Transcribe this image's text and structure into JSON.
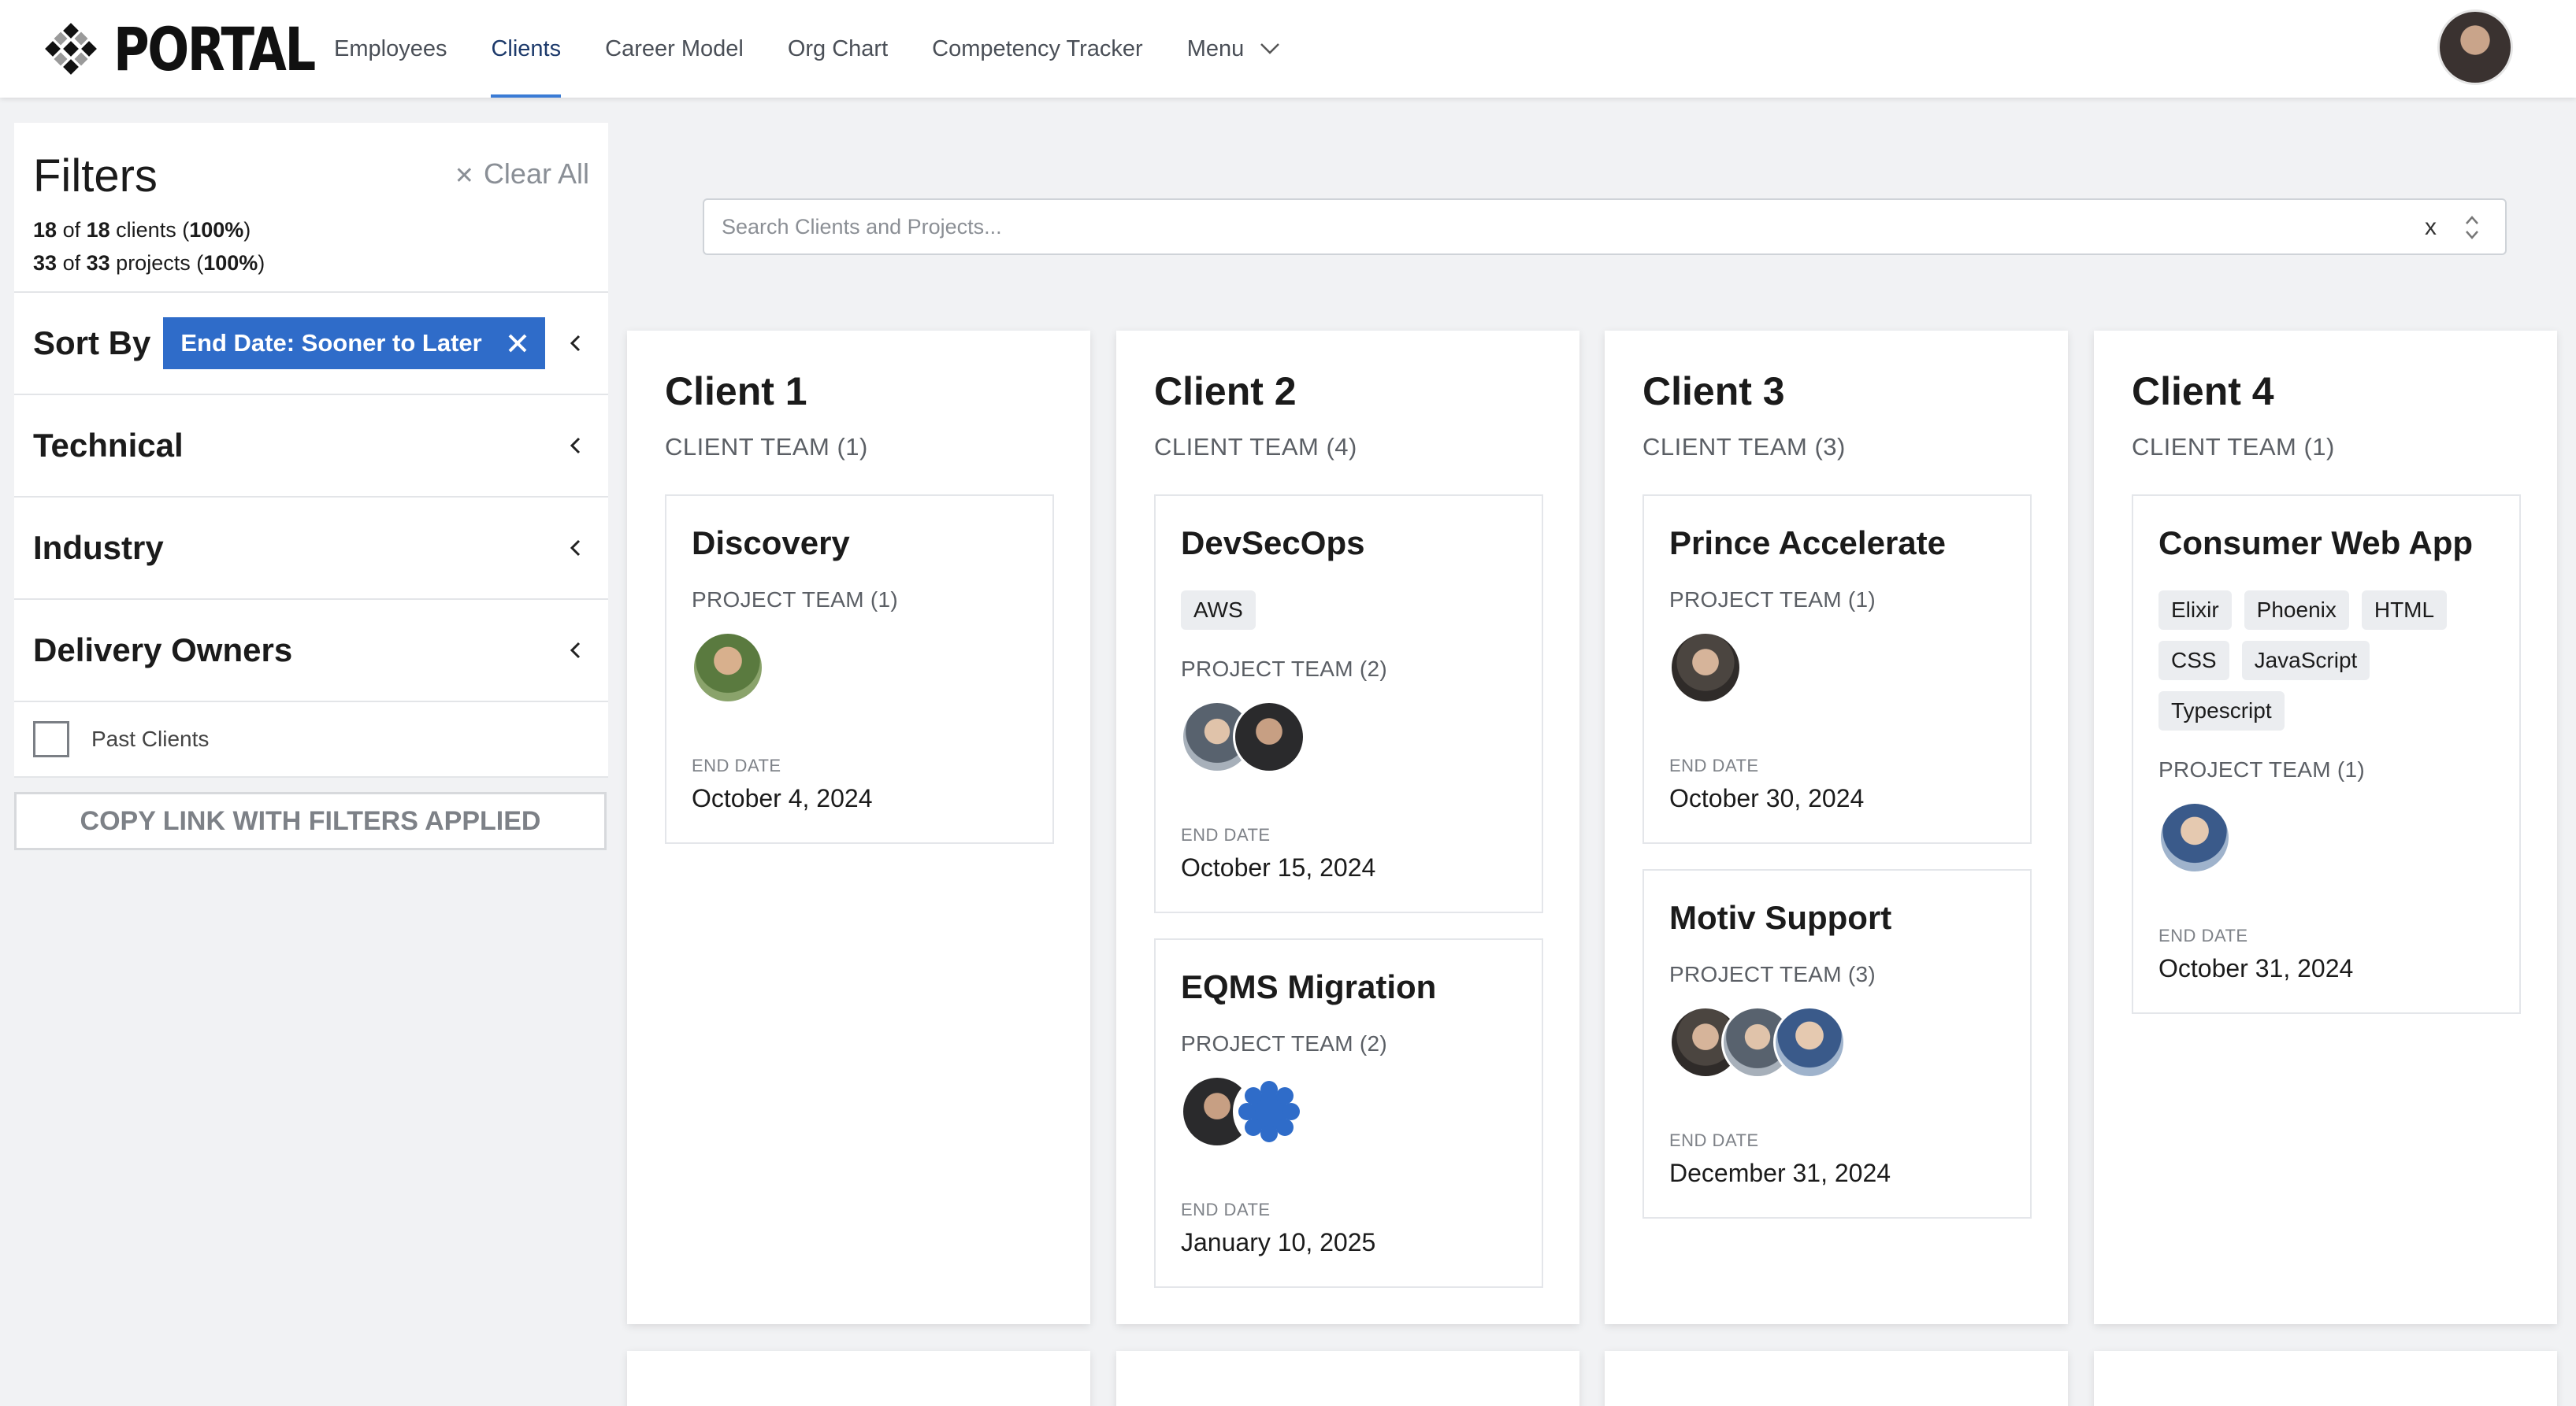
{
  "app": {
    "logo_text": "PORTAL"
  },
  "nav": {
    "items": [
      {
        "label": "Employees"
      },
      {
        "label": "Clients"
      },
      {
        "label": "Career Model"
      },
      {
        "label": "Org Chart"
      },
      {
        "label": "Competency Tracker"
      },
      {
        "label": "Menu"
      }
    ],
    "active": "Clients"
  },
  "filters": {
    "title": "Filters",
    "clear_all": "Clear All",
    "clients_shown": "18",
    "clients_total": "18",
    "clients_word": "clients",
    "clients_pct": "100%",
    "projects_shown": "33",
    "projects_total": "33",
    "projects_word": "projects",
    "projects_pct": "100%",
    "of_word": "of",
    "sort_label": "Sort By",
    "sort_value": "End Date: Sooner to Later",
    "sections": [
      "Technical",
      "Industry",
      "Delivery Owners"
    ],
    "past_clients_label": "Past Clients",
    "past_clients_checked": false,
    "copy_link_label": "COPY LINK WITH FILTERS APPLIED"
  },
  "search": {
    "placeholder": "Search Clients and Projects...",
    "clear": "x"
  },
  "labels": {
    "project_team_prefix": "PROJECT TEAM",
    "end_date": "END DATE"
  },
  "clients": [
    {
      "name": "Client 1",
      "team": "CLIENT TEAM (1)",
      "projects": [
        {
          "name": "Discovery",
          "team": "PROJECT TEAM (1)",
          "end_date": "October 4, 2024",
          "tags": []
        }
      ]
    },
    {
      "name": "Client 2",
      "team": "CLIENT TEAM (4)",
      "projects": [
        {
          "name": "DevSecOps",
          "team": "PROJECT TEAM (2)",
          "end_date": "October 15, 2024",
          "tags": [
            "AWS"
          ]
        },
        {
          "name": "EQMS Migration",
          "team": "PROJECT TEAM (2)",
          "end_date": "January 10, 2025",
          "tags": []
        }
      ]
    },
    {
      "name": "Client 3",
      "team": "CLIENT TEAM (3)",
      "projects": [
        {
          "name": "Prince Accelerate",
          "team": "PROJECT TEAM (1)",
          "end_date": "October 30, 2024",
          "tags": []
        },
        {
          "name": "Motiv Support",
          "team": "PROJECT TEAM (3)",
          "end_date": "December 31, 2024",
          "tags": []
        }
      ]
    },
    {
      "name": "Client 4",
      "team": "CLIENT TEAM (1)",
      "projects": [
        {
          "name": "Consumer Web App",
          "team": "PROJECT TEAM (1)",
          "end_date": "October 31, 2024",
          "tags": [
            "Elixir",
            "Phoenix",
            "HTML",
            "CSS",
            "JavaScript",
            "Typescript"
          ]
        }
      ]
    }
  ],
  "colors": {
    "accent": "#3a7bd5",
    "sort_chip": "#2f6cc9",
    "background": "#f1f2f4"
  },
  "icons": [
    "logo-mark-icon",
    "chevron-down-icon",
    "close-icon",
    "chevron-left-icon",
    "sort-arrows-icon",
    "star-avatar-icon"
  ]
}
